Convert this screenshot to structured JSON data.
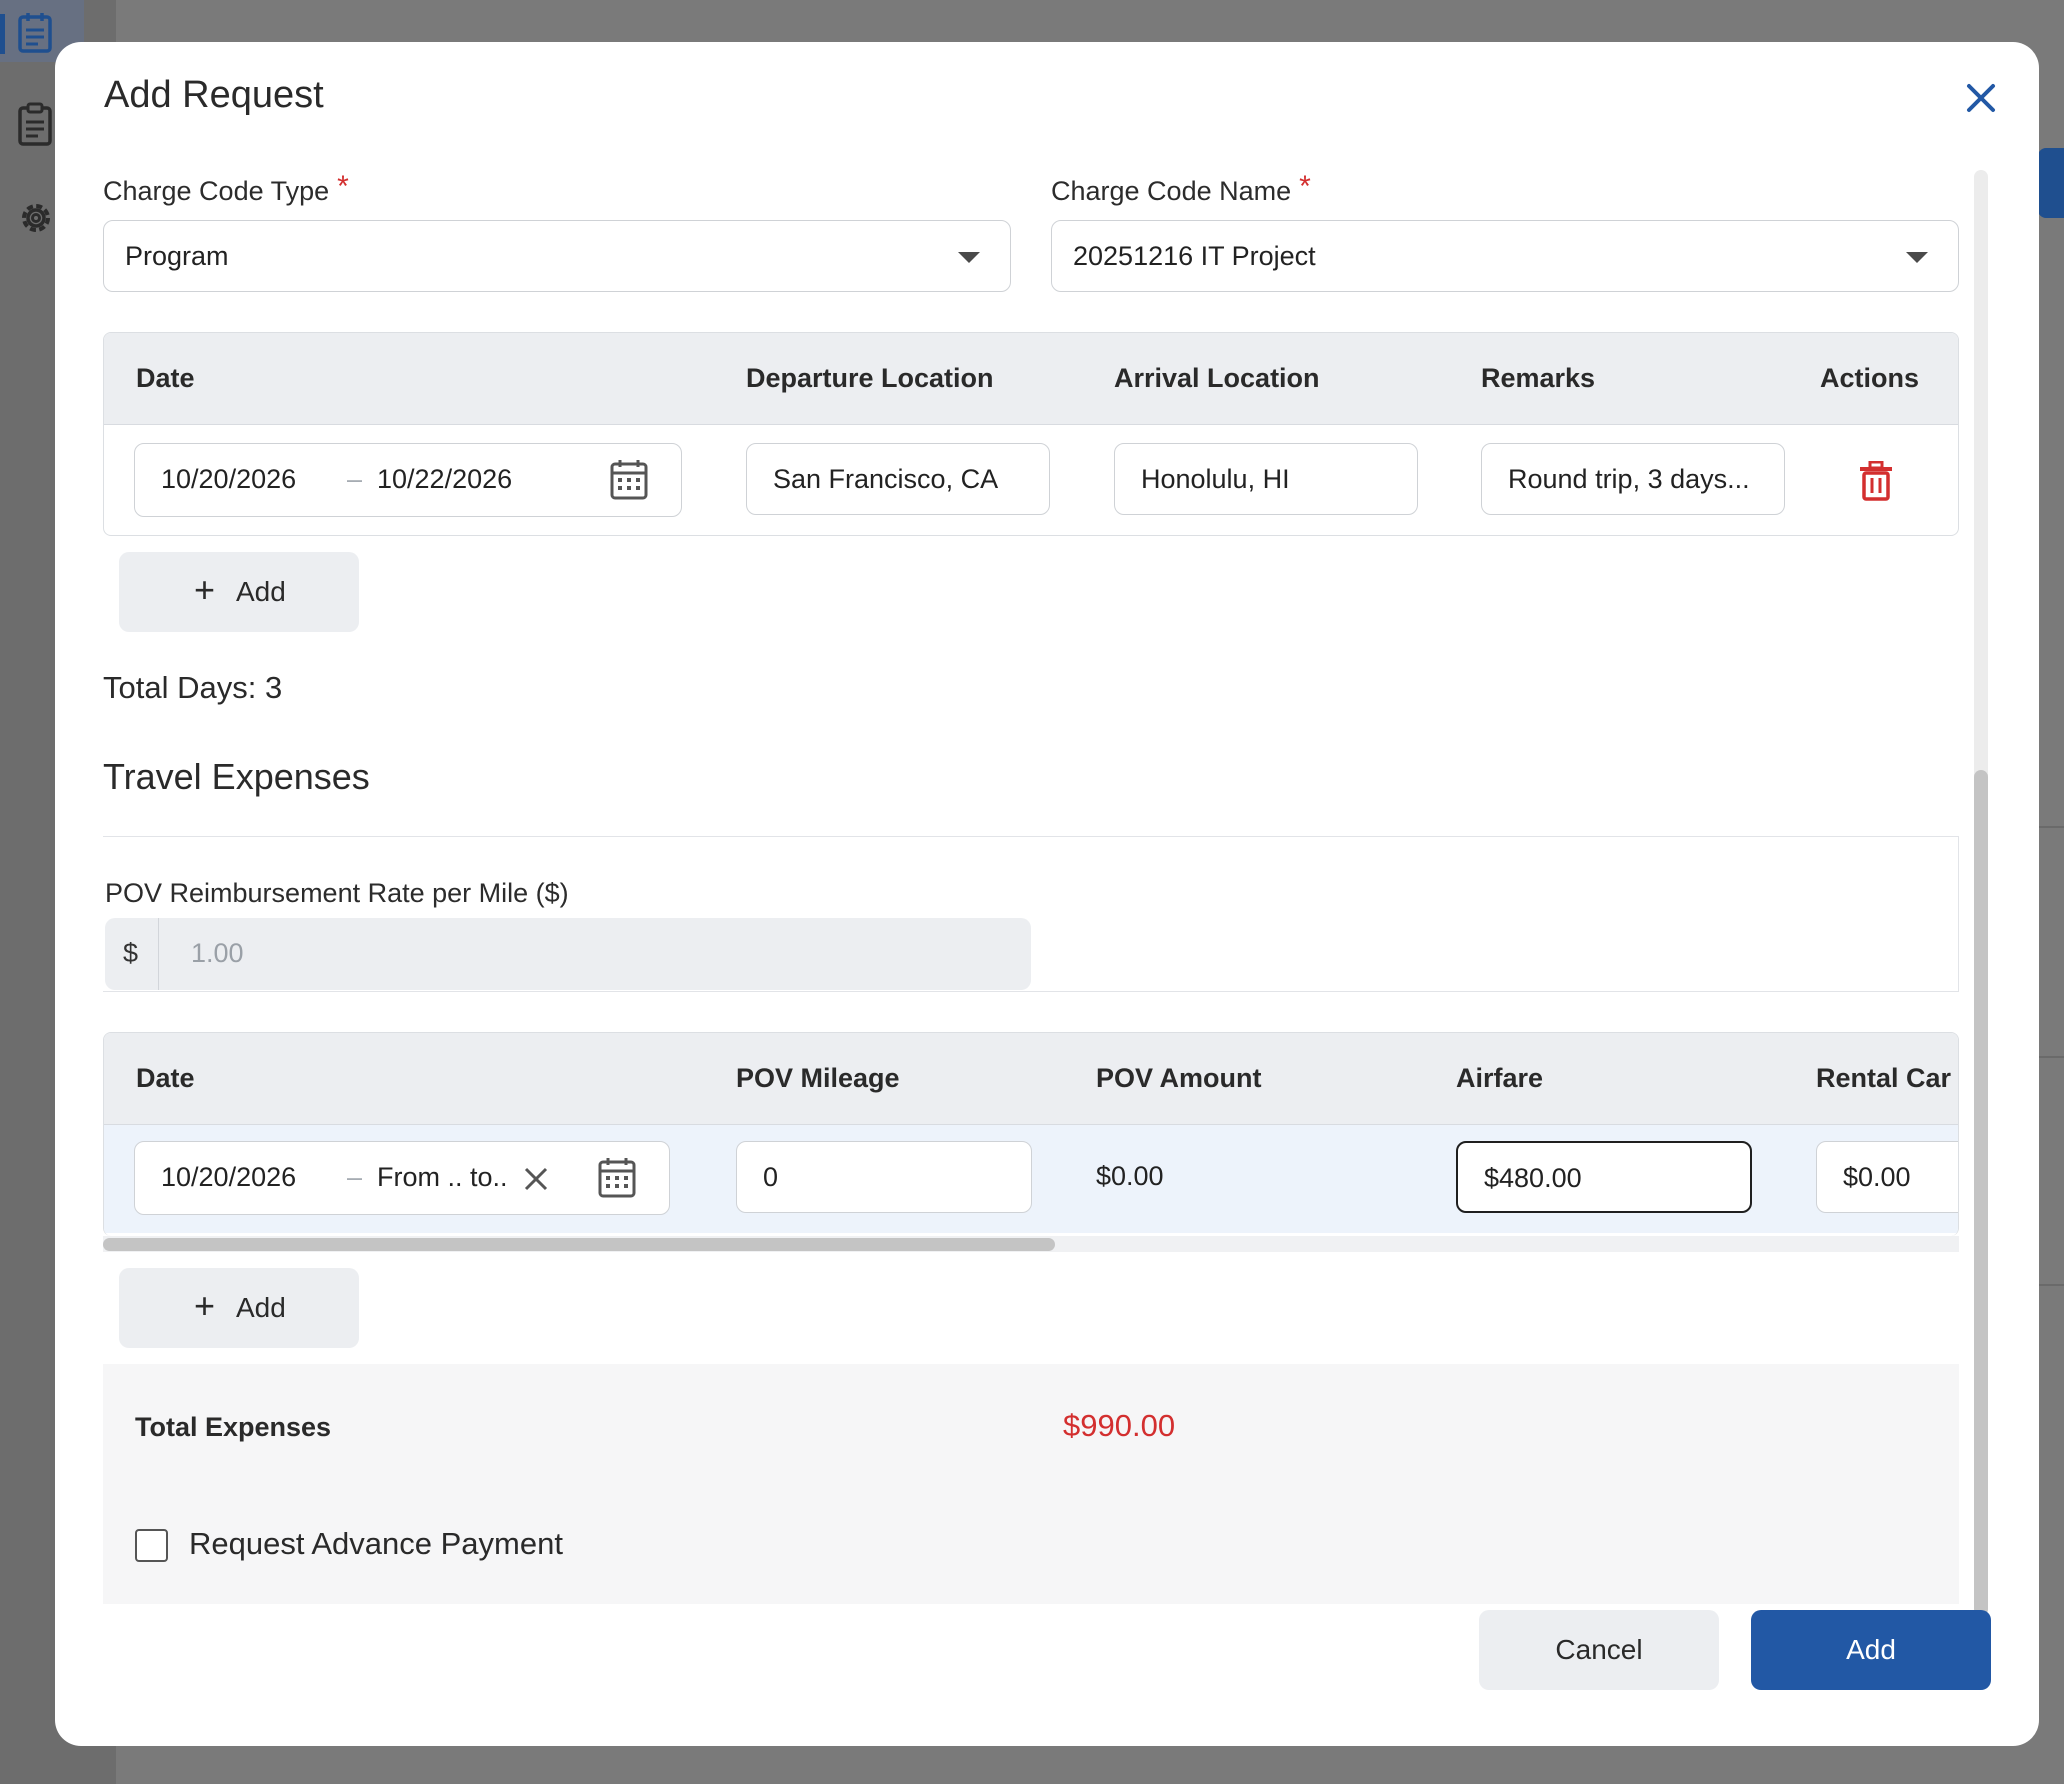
{
  "modal": {
    "title": "Add Request",
    "charge_code_type": {
      "label": "Charge Code Type",
      "required_mark": "*",
      "value": "Program"
    },
    "charge_code_name": {
      "label": "Charge Code Name",
      "required_mark": "*",
      "value": "20251216 IT Project"
    }
  },
  "itinerary": {
    "headers": [
      "Date",
      "Departure Location",
      "Arrival Location",
      "Remarks",
      "Actions"
    ],
    "rows": [
      {
        "date_from": "10/20/2026",
        "date_to": "10/22/2026",
        "departure": "San Francisco, CA",
        "arrival": "Honolulu, HI",
        "remarks": "Round trip, 3 days..."
      }
    ],
    "add_label": "Add",
    "total_days": "Total Days: 3"
  },
  "travel_expenses": {
    "heading": "Travel Expenses",
    "rate_label": "POV Reimbursement Rate per Mile ($)",
    "rate_prefix": "$",
    "rate_value": "1.00",
    "headers": [
      "Date",
      "POV Mileage",
      "POV Amount",
      "Airfare",
      "Rental Car"
    ],
    "rows": [
      {
        "date_from": "10/20/2026",
        "date_to_placeholder": "From .. to..",
        "pov_mileage": "0",
        "pov_amount": "$0.00",
        "airfare": "$480.00",
        "rental_car": "$0.00"
      }
    ],
    "add_label": "Add",
    "total_label": "Total Expenses",
    "total_value": "$990.00",
    "advance_payment_label": "Request Advance Payment",
    "advance_payment_checked": false
  },
  "footer": {
    "cancel_label": "Cancel",
    "add_label": "Add"
  },
  "colors": {
    "accent": "#2258a5",
    "danger": "#d32f2f",
    "header_bg": "#eceef1"
  },
  "icons": {
    "close": "close-icon",
    "calendar": "calendar-icon",
    "delete": "trash-icon",
    "clear": "clear-icon",
    "plus": "plus-icon"
  }
}
